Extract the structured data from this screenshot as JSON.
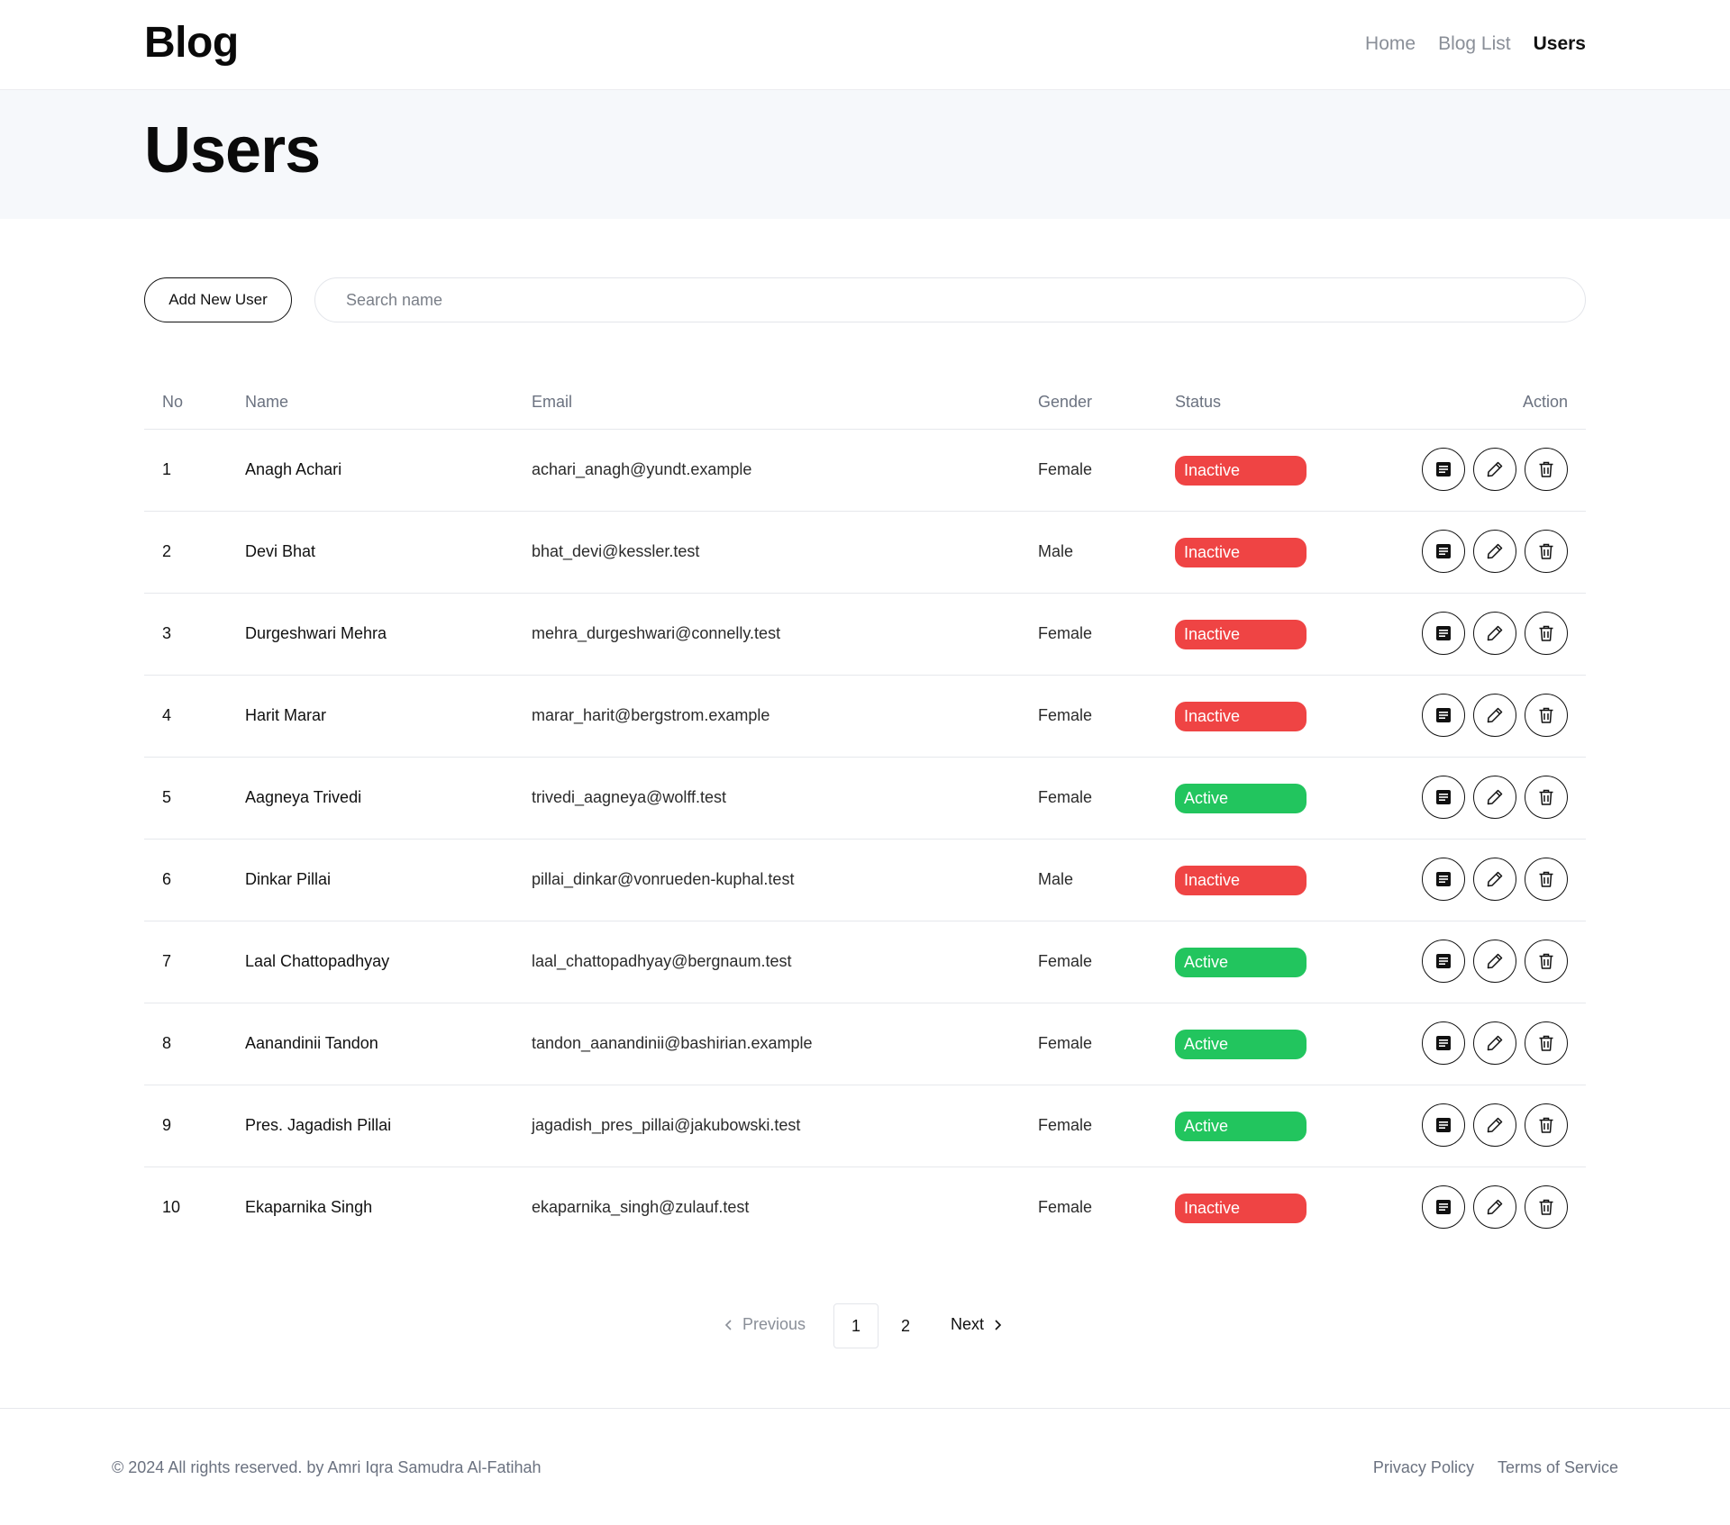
{
  "header": {
    "logo": "Blog",
    "nav": [
      {
        "label": "Home"
      },
      {
        "label": "Blog List"
      },
      {
        "label": "Users"
      }
    ]
  },
  "hero": {
    "title": "Users"
  },
  "controls": {
    "add_label": "Add New User",
    "search_placeholder": "Search name",
    "search_value": ""
  },
  "table": {
    "columns": {
      "no": "No",
      "name": "Name",
      "email": "Email",
      "gender": "Gender",
      "status": "Status",
      "action": "Action"
    },
    "rows": [
      {
        "no": "1",
        "name": "Anagh Achari",
        "email": "achari_anagh@yundt.example",
        "gender": "Female",
        "status": "Inactive"
      },
      {
        "no": "2",
        "name": "Devi Bhat",
        "email": "bhat_devi@kessler.test",
        "gender": "Male",
        "status": "Inactive"
      },
      {
        "no": "3",
        "name": "Durgeshwari Mehra",
        "email": "mehra_durgeshwari@connelly.test",
        "gender": "Female",
        "status": "Inactive"
      },
      {
        "no": "4",
        "name": "Harit Marar",
        "email": "marar_harit@bergstrom.example",
        "gender": "Female",
        "status": "Inactive"
      },
      {
        "no": "5",
        "name": "Aagneya Trivedi",
        "email": "trivedi_aagneya@wolff.test",
        "gender": "Female",
        "status": "Active"
      },
      {
        "no": "6",
        "name": "Dinkar Pillai",
        "email": "pillai_dinkar@vonrueden-kuphal.test",
        "gender": "Male",
        "status": "Inactive"
      },
      {
        "no": "7",
        "name": "Laal Chattopadhyay",
        "email": "laal_chattopadhyay@bergnaum.test",
        "gender": "Female",
        "status": "Active"
      },
      {
        "no": "8",
        "name": "Aanandinii Tandon",
        "email": "tandon_aanandinii@bashirian.example",
        "gender": "Female",
        "status": "Active"
      },
      {
        "no": "9",
        "name": "Pres. Jagadish Pillai",
        "email": "jagadish_pres_pillai@jakubowski.test",
        "gender": "Female",
        "status": "Active"
      },
      {
        "no": "10",
        "name": "Ekaparnika Singh",
        "email": "ekaparnika_singh@zulauf.test",
        "gender": "Female",
        "status": "Inactive"
      }
    ],
    "action_icons": [
      "detail-icon",
      "edit-pencil-icon",
      "trash-icon"
    ]
  },
  "pagination": {
    "prev_label": "Previous",
    "next_label": "Next",
    "pages": [
      "1",
      "2"
    ],
    "current": "1"
  },
  "footer": {
    "copyright": "© 2024 All rights reserved. by Amri Iqra Samudra Al-Fatihah",
    "links": [
      "Privacy Policy",
      "Terms of Service"
    ]
  },
  "colors": {
    "inactive": "#ef4444",
    "active": "#22c55e",
    "hero_bg": "#f6f8fb"
  }
}
